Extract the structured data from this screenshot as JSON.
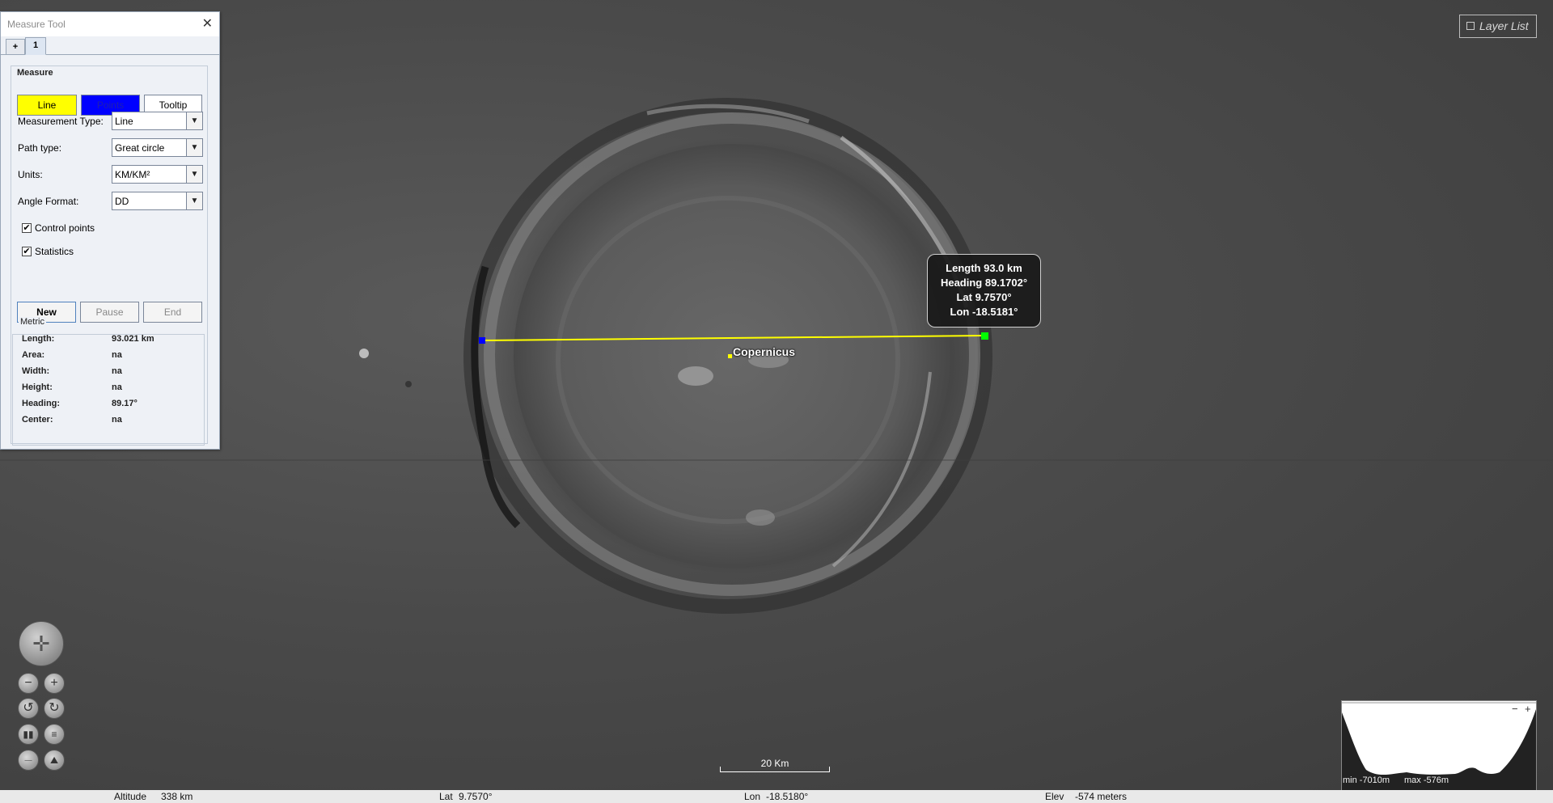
{
  "measure_window": {
    "title": "Measure Tool",
    "tabs": [
      "+",
      "1"
    ],
    "group_title": "Measure",
    "mode_buttons": {
      "line": "Line",
      "points": "Points",
      "tooltip": "Tooltip"
    },
    "fields": {
      "measurement_type": {
        "label": "Measurement Type:",
        "value": "Line"
      },
      "path_type": {
        "label": "Path type:",
        "value": "Great circle"
      },
      "units": {
        "label": "Units:",
        "value": "KM/KM²"
      },
      "angle_format": {
        "label": "Angle Format:",
        "value": "DD"
      }
    },
    "checkboxes": {
      "control_points": {
        "label": "Control points",
        "checked": true
      },
      "statistics": {
        "label": "Statistics",
        "checked": true
      }
    },
    "controls": {
      "new": "New",
      "pause": "Pause",
      "end": "End"
    },
    "metric": {
      "title": "Metric",
      "rows": [
        {
          "label": "Length:",
          "value": "93.021 km"
        },
        {
          "label": "Area:",
          "value": "na"
        },
        {
          "label": "Width:",
          "value": "na"
        },
        {
          "label": "Height:",
          "value": "na"
        },
        {
          "label": "Heading:",
          "value": "89.17°"
        },
        {
          "label": "Center:",
          "value": "na"
        }
      ]
    },
    "check_glyph": "✔",
    "combo_arrow": "▼"
  },
  "layer_list": {
    "label": "Layer List"
  },
  "tooltip": {
    "length": "Length 93.0 km",
    "heading": "Heading 89.1702°",
    "lat": "Lat 9.7570°",
    "lon": "Lon -18.5181°"
  },
  "map_label": "Copernicus",
  "measure_line": {
    "color": "#ffff00",
    "start_point_color": "#0000ff",
    "end_point_color": "#00ff00"
  },
  "scalebar": {
    "label": "20 Km"
  },
  "profile": {
    "min": "min -7010m",
    "max": "max -576m",
    "minus": "−",
    "plus": "+"
  },
  "nav_icons": {
    "pan": "pan-compass-icon",
    "zoom_out": "zoom-out-icon",
    "zoom_in": "zoom-in-icon",
    "rotate_left": "rotate-left-icon",
    "rotate_right": "rotate-right-icon",
    "tilt_up": "tilt-up-icon",
    "tilt_down": "tilt-down-icon",
    "exaggeration_down": "exaggeration-down-icon",
    "exaggeration_up": "exaggeration-up-icon"
  },
  "status_bar": {
    "altitude_label": "Altitude",
    "altitude": "338 km",
    "lat_label": "Lat",
    "lat": "9.7570°",
    "lon_label": "Lon",
    "lon": "-18.5180°",
    "elev_label": "Elev",
    "elev": "-574 meters"
  }
}
